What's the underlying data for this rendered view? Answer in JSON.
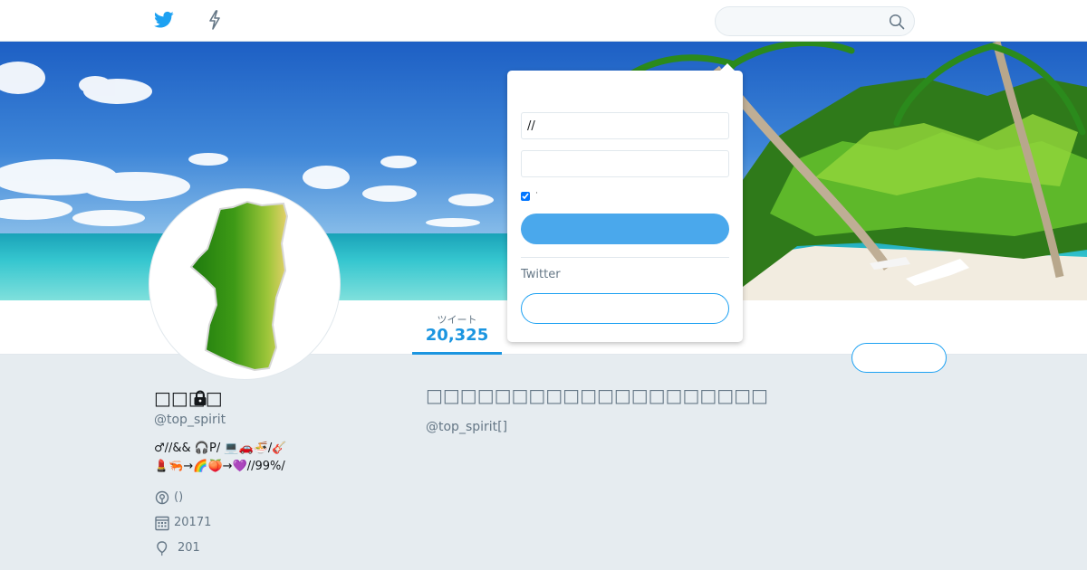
{
  "nav": {
    "home_icon": "twitter-bird-icon",
    "moments_icon": "lightning-icon",
    "search": {
      "value": "",
      "placeholder": "",
      "icon": "search-icon"
    }
  },
  "profile": {
    "name": "□□□□",
    "handle": "@top_spirit",
    "bio_line_1": "♂//&&  🎧P/          💻🚗🍜/🎸",
    "bio_line_2": "💄🦐→🌈🍑→💜//99%/",
    "location": "()",
    "joined": "20171",
    "birthday": "201"
  },
  "stats": {
    "tweets_label": "ツイート",
    "tweets_value": "20,325"
  },
  "follow_button": {
    "label": ""
  },
  "protected": {
    "title": "□□□□□□□□□□□□□□□□□□□□",
    "subtitle": "@top_spirit[]"
  },
  "login": {
    "username_value": "//",
    "password_value": "",
    "remember_label": "·",
    "login_button_label": "",
    "signup_prompt": "Twitter",
    "signup_button_label": ""
  },
  "colors": {
    "accent": "#1da1f2",
    "login_button": "#4aa8ec",
    "page_background": "#e6ecf0"
  }
}
